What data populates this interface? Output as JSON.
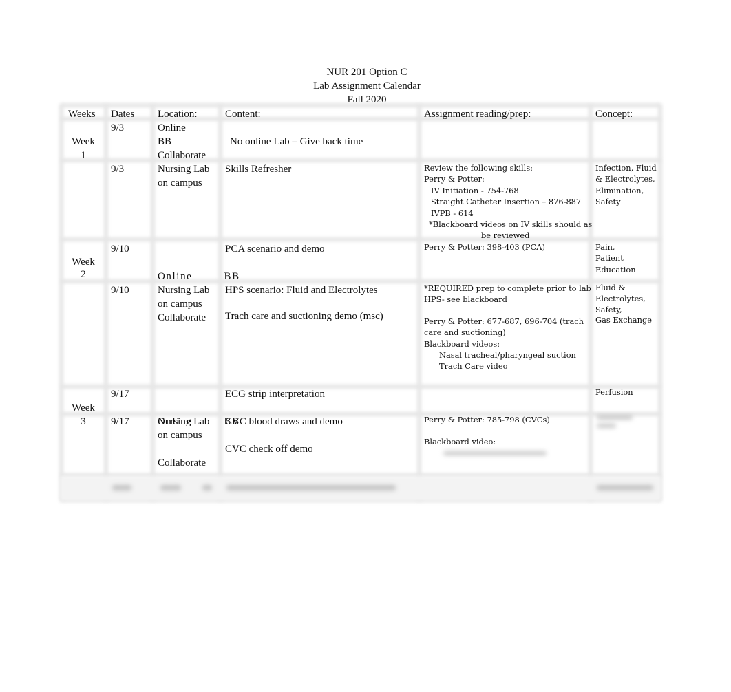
{
  "document": {
    "title_lines": [
      "NUR 201 Option C",
      "Lab Assignment Calendar",
      "Fall 2020"
    ]
  },
  "table": {
    "headers": {
      "weeks": "Weeks",
      "dates": "Dates",
      "location": "Location:",
      "content": "Content:",
      "reading": "Assignment reading/prep:",
      "concept": "Concept:"
    },
    "weeks": [
      {
        "label_line1": "Week",
        "label_line2": "1",
        "sessions": [
          {
            "date": "9/3",
            "location_lines": [
              "Online",
              "BB",
              "Collaborate"
            ],
            "content_lines": [
              "No online Lab – Give back time"
            ],
            "reading_lines": [],
            "concept_lines": []
          },
          {
            "date": "9/3",
            "location_lines": [
              "Nursing Lab",
              "on campus"
            ],
            "content_lines": [
              "Skills Refresher"
            ],
            "reading_lines": [
              "Review the following skills:",
              "Perry & Potter:",
              "IV Initiation - 754-768",
              "Straight Catheter Insertion – 876-887",
              "IVPB - 614",
              "*Blackboard videos on IV skills should as",
              "be reviewed"
            ],
            "concept_lines": [
              "Infection, Fluid",
              "& Electrolytes,",
              "Elimination,",
              "Safety"
            ]
          }
        ]
      },
      {
        "label_line1": "Week",
        "label_line2": "2",
        "sessions": [
          {
            "date": "9/10",
            "location_lines": [
              "Online   BB",
              "Collaborate"
            ],
            "content_lines": [
              "PCA scenario and demo"
            ],
            "reading_lines": [
              "Perry & Potter: 398-403 (PCA)"
            ],
            "concept_lines": [
              "Pain,",
              "Patient",
              "Education"
            ]
          },
          {
            "date": "9/10",
            "location_lines": [
              "Nursing Lab",
              "on campus"
            ],
            "content_lines": [
              "HPS scenario: Fluid and Electrolytes",
              "Trach care and suctioning demo (msc)"
            ],
            "reading_lines": [
              "*REQUIRED prep to complete prior to lab",
              "HPS- see blackboard",
              "Perry & Potter: 677-687, 696-704 (trach",
              "care and suctioning)",
              "Blackboard videos:",
              "Nasal tracheal/pharyngeal suction",
              "Trach Care video"
            ],
            "concept_lines": [
              "Fluid &",
              "Electrolytes,",
              "Safety,",
              "Gas Exchange"
            ]
          }
        ]
      },
      {
        "label_line1": "Week",
        "label_line2": "3",
        "sessions": [
          {
            "date": "9/17",
            "location_lines": [
              "Online   BB",
              "Collaborate"
            ],
            "content_lines": [
              "ECG strip interpretation"
            ],
            "reading_lines": [],
            "concept_lines": [
              "Perfusion"
            ]
          },
          {
            "date": "9/17",
            "location_lines": [
              "Nursing Lab",
              "on campus"
            ],
            "content_lines": [
              "CVC blood draws and demo",
              "CVC check off demo"
            ],
            "reading_lines": [
              "Perry & Potter:  785-798 (CVCs)",
              "Blackboard video:"
            ],
            "concept_lines": []
          }
        ]
      }
    ]
  }
}
